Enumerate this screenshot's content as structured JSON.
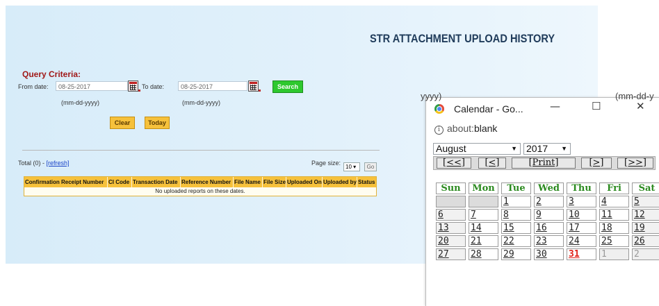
{
  "page": {
    "title": "STR ATTACHMENT UPLOAD HISTORY",
    "query_criteria": "Query Criteria:",
    "from_label": "From date:",
    "from_value": "08-25-2017",
    "to_label": "To date:",
    "to_value": "08-25-2017",
    "date_format_hint": "(mm-dd-yyyy)",
    "search_label": "Search",
    "clear_label": "Clear",
    "today_label": "Today",
    "total_text": "Total (0) - ",
    "refresh_link": "[refresh]",
    "page_size_label": "Page size:",
    "page_size_value": "10",
    "go_label": "Go",
    "columns": [
      "Confirmation Receipt Number",
      "CI Code",
      "Transaction Date",
      "Reference Number",
      "File Name",
      "File Size",
      "Uploaded On",
      "Uploaded by",
      "Status"
    ],
    "empty_message": "No uploaded reports on these dates."
  },
  "popup": {
    "background_text_left": "yyyy)",
    "background_text_right": "(mm-dd-y",
    "window_title": "Calendar - Go...",
    "minimize": "—",
    "maximize": "☐",
    "close": "✕",
    "address_prefix": "about:",
    "address_value": "blank",
    "month_value": "August",
    "year_value": "2017",
    "nav": [
      "[<<]",
      "[<]",
      "[Print]",
      "[>]",
      "[>>]"
    ],
    "weekdays": [
      "Sun",
      "Mon",
      "Tue",
      "Wed",
      "Thu",
      "Fri",
      "Sat"
    ],
    "weeks": [
      [
        "",
        "",
        "1",
        "2",
        "3",
        "4",
        "5"
      ],
      [
        "6",
        "7",
        "8",
        "9",
        "10",
        "11",
        "12"
      ],
      [
        "13",
        "14",
        "15",
        "16",
        "17",
        "18",
        "19"
      ],
      [
        "20",
        "21",
        "22",
        "23",
        "24",
        "25",
        "26"
      ],
      [
        "27",
        "28",
        "29",
        "30",
        "31",
        "1",
        "2"
      ]
    ],
    "highlight_day": "31",
    "colors": {
      "header_green": "#2b8a1f",
      "today_red": "#e0221a"
    }
  }
}
